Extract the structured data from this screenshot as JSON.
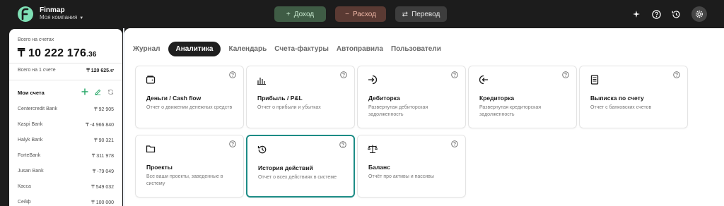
{
  "app": {
    "name": "Finmap",
    "company": "Моя компания"
  },
  "toolbar": {
    "income_label": "Доход",
    "expense_label": "Расход",
    "transfer_label": "Перевод"
  },
  "sidebar": {
    "total_label": "Всего на счетах",
    "total_main": "₸ 10 222 176",
    "total_cents": ".36",
    "per_account_label": "Всего на 1 счете",
    "per_account_main": "₸ 120 625",
    "per_account_cents": ".47",
    "accounts_title": "Мои счета",
    "accounts": [
      {
        "name": "Centercredit Bank",
        "value": "₸ 92 905"
      },
      {
        "name": "Kaspi Bank",
        "value": "₸ -4 966 840"
      },
      {
        "name": "Halyk Bank",
        "value": "₸ 90 321"
      },
      {
        "name": "ForteBank",
        "value": "₸ 311 978"
      },
      {
        "name": "Jusan Bank",
        "value": "₸ -79 049"
      },
      {
        "name": "Касса",
        "value": "₸ 549 032"
      },
      {
        "name": "Сейф",
        "value": "₸ 100 000"
      }
    ]
  },
  "tabs": [
    {
      "label": "Журнал"
    },
    {
      "label": "Аналитика",
      "active": true
    },
    {
      "label": "Календарь"
    },
    {
      "label": "Счета-фактуры"
    },
    {
      "label": "Автоправила"
    },
    {
      "label": "Пользователи"
    }
  ],
  "reports": [
    {
      "title": "Деньги / Cash flow",
      "desc": "Отчет о движении денежных средств",
      "icon": "wallet-icon"
    },
    {
      "title": "Прибыль / P&L",
      "desc": "Отчет о прибыли и убытках",
      "icon": "bar-chart-icon"
    },
    {
      "title": "Дебиторка",
      "desc": "Развернутая дебиторская задолженность",
      "icon": "arrow-in-circle-icon"
    },
    {
      "title": "Кредиторка",
      "desc": "Развернутая кредиторская задолженность",
      "icon": "arrow-out-circle-icon"
    },
    {
      "title": "Выписка по счету",
      "desc": "Отчет с банковских счетов",
      "icon": "document-icon"
    },
    {
      "title": "Проекты",
      "desc": "Все ваши проекты, заведенные в систему",
      "icon": "folder-icon"
    },
    {
      "title": "История действий",
      "desc": "Отчет о всех действиях в системе",
      "icon": "history-icon",
      "selected": true
    },
    {
      "title": "Баланс",
      "desc": "Отчёт про активы и пассивы",
      "icon": "scales-icon"
    }
  ],
  "colors": {
    "selected_border": "#1d8c86",
    "logo_green": "#7fe0b5",
    "income_bg": "#3f5c45",
    "expense_bg": "#5a3a33"
  }
}
